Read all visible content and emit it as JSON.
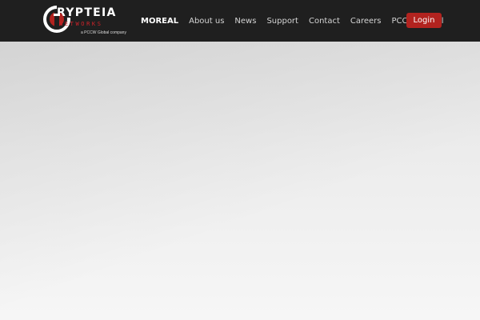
{
  "brand": {
    "name": "RYPTEIA",
    "subname": "NETWORKS",
    "tagline": "a PCCW Global company"
  },
  "nav": {
    "items": [
      {
        "label": "MOREAL",
        "active": true
      },
      {
        "label": "About us",
        "active": false
      },
      {
        "label": "News",
        "active": false
      },
      {
        "label": "Support",
        "active": false
      },
      {
        "label": "Contact",
        "active": false
      },
      {
        "label": "Careers",
        "active": false
      },
      {
        "label": "PCCW Global",
        "active": false
      }
    ],
    "login_label": "Login"
  },
  "colors": {
    "navbar_bg": "#1f1f1f",
    "accent_red": "#b2231f",
    "hero_bg": "#ececec"
  }
}
